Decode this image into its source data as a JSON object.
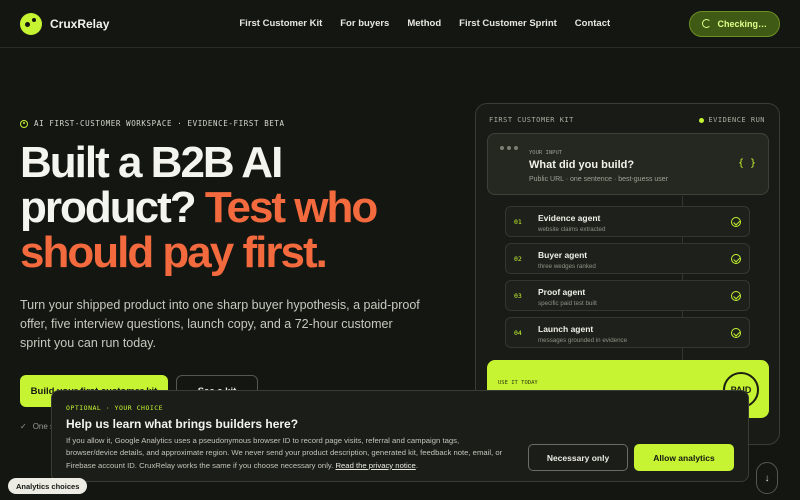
{
  "nav": {
    "brand": "CruxRelay",
    "links": [
      "First Customer Kit",
      "For buyers",
      "Method",
      "First Customer Sprint",
      "Contact"
    ],
    "cta_label": "Checking…"
  },
  "hero": {
    "eyebrow": "AI FIRST-CUSTOMER WORKSPACE · EVIDENCE-FIRST BETA",
    "headline_line1": "Built a B2B AI",
    "headline_line2_plain": "product? ",
    "headline_line2_accent": "Test who",
    "headline_line3_accent": "should pay first.",
    "subtext": "Turn your shipped product into one sharp buyer hypothesis, a paid-proof offer, five interview questions, launch copy, and a 72-hour customer sprint you can run today.",
    "primary_button": "Build your first customer kit",
    "secondary_button": "See a kit",
    "note": "One sharp hypothesis"
  },
  "panel": {
    "title": "FIRST CUSTOMER KIT",
    "status": "EVIDENCE RUN",
    "input": {
      "eyebrow": "YOUR INPUT",
      "title": "What did you build?",
      "description": "Public URL · one sentence · best-guess user",
      "icon": "{ }"
    },
    "agents": [
      {
        "num": "01",
        "name": "Evidence agent",
        "sub": "website claims extracted"
      },
      {
        "num": "02",
        "name": "Buyer agent",
        "sub": "three wedges ranked"
      },
      {
        "num": "03",
        "name": "Proof agent",
        "sub": "specific paid test built"
      },
      {
        "num": "04",
        "name": "Launch agent",
        "sub": "messages grounded in evidence"
      }
    ],
    "use_label": "USE IT TODAY",
    "stamp": "PAID"
  },
  "consent": {
    "eyebrow": "OPTIONAL · YOUR CHOICE",
    "title": "Help us learn what brings builders here?",
    "text": "If you allow it, Google Analytics uses a pseudonymous browser ID to record page visits, referral and campaign tags, browser/device details, and approximate region. We never send your product description, generated kit, feedback note, email, or Firebase account ID. CruxRelay works the same if you choose necessary only. ",
    "link": "Read the privacy notice",
    "link_suffix": ".",
    "necessary_button": "Necessary only",
    "allow_button": "Allow analytics"
  },
  "analytics_pill": "Analytics choices",
  "scroll_icon": "↓",
  "colors": {
    "background": "#141612",
    "accent_lime": "#c6f432",
    "accent_orange": "#f26a3d"
  }
}
